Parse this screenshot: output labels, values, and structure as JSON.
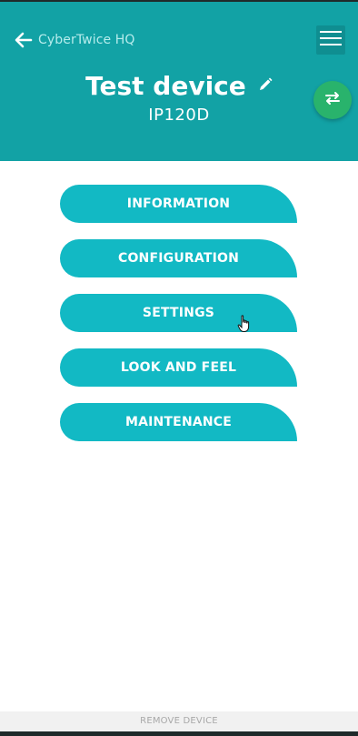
{
  "header": {
    "back_label": "CyberTwice HQ",
    "device_name": "Test device",
    "device_model": "IP120D",
    "background_color": "#12a2a5",
    "icons": {
      "back": "arrow-left-icon",
      "menu": "hamburger-menu-icon",
      "edit": "pencil-icon",
      "swap": "swap-arrows-icon"
    }
  },
  "menu": {
    "button_color": "#12b9c4",
    "items": [
      {
        "label": "INFORMATION"
      },
      {
        "label": "CONFIGURATION"
      },
      {
        "label": "SETTINGS"
      },
      {
        "label": "LOOK AND FEEL"
      },
      {
        "label": "MAINTENANCE"
      }
    ]
  },
  "footer": {
    "remove_label": "REMOVE DEVICE"
  },
  "fab_color": "#29b36c"
}
